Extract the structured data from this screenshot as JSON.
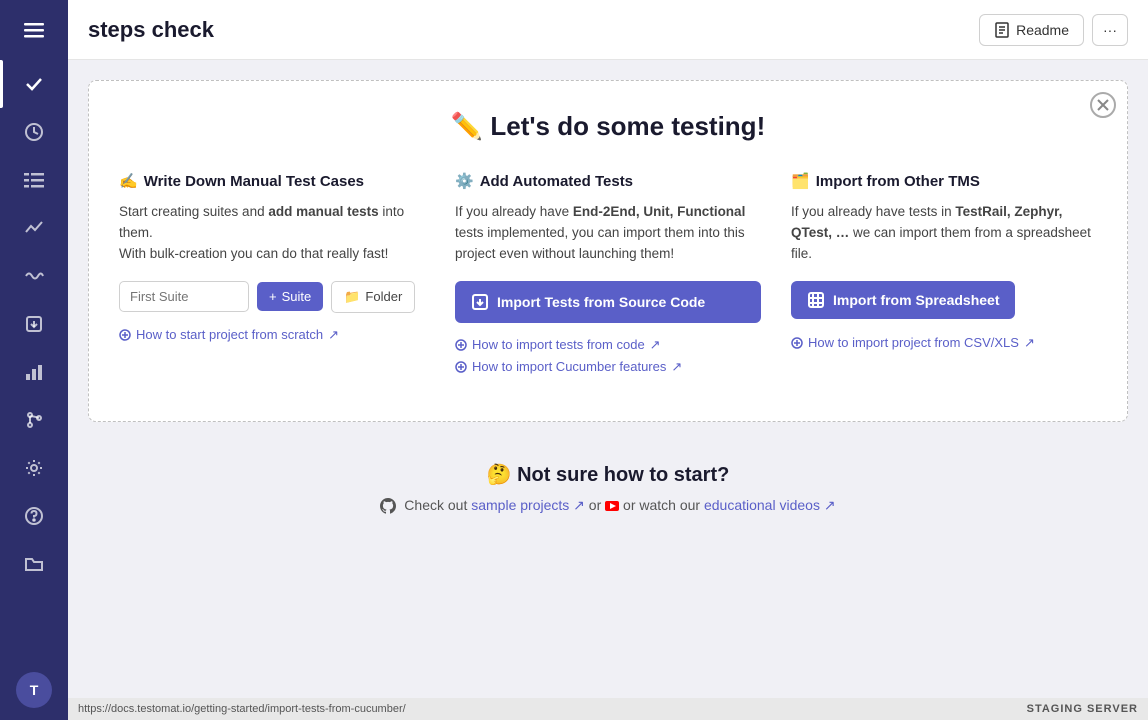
{
  "sidebar": {
    "items": [
      {
        "id": "hamburger",
        "icon": "☰"
      },
      {
        "id": "check",
        "icon": "✓",
        "active": true
      },
      {
        "id": "circle",
        "icon": "⏱"
      },
      {
        "id": "list",
        "icon": "≡"
      },
      {
        "id": "graph",
        "icon": "📈"
      },
      {
        "id": "wave",
        "icon": "〜"
      },
      {
        "id": "import",
        "icon": "⬆"
      },
      {
        "id": "chart",
        "icon": "📊"
      },
      {
        "id": "branch",
        "icon": "⑂"
      },
      {
        "id": "settings",
        "icon": "⚙"
      },
      {
        "id": "help",
        "icon": "?"
      },
      {
        "id": "folder",
        "icon": "📁"
      }
    ],
    "avatar_label": "T"
  },
  "header": {
    "title": "steps check",
    "readme_label": "Readme",
    "more_label": "···"
  },
  "card": {
    "title": "✏️ Let's do some testing!",
    "close_icon": "✕",
    "col1": {
      "icon": "✍",
      "title": "Write Down Manual Test Cases",
      "desc_plain": "Start creating suites and ",
      "desc_bold": "add manual tests",
      "desc_plain2": " into them.\nWith bulk-creation you can do that really fast!",
      "input_placeholder": "First Suite",
      "btn_suite_label": "+ Suite",
      "btn_folder_label": "📁 Folder",
      "help_link": "How to start project from scratch",
      "help_link_icon": "↗"
    },
    "col2": {
      "icon": "⚙",
      "title": "Add Automated Tests",
      "desc_plain": "If you already have ",
      "desc_bold": "End-2End, Unit, Functional",
      "desc_plain2": " tests implemented, you can import them into this project even without launching them!",
      "btn_import_label": "Import Tests from Source Code",
      "btn_import_icon": "⬆",
      "help_link1": "How to import tests from code",
      "help_link1_icon": "↗",
      "help_link2": "How to import Cucumber features",
      "help_link2_icon": "↗"
    },
    "col3": {
      "icon": "🗂",
      "title": "Import from Other TMS",
      "desc_plain": "If you already have tests in ",
      "desc_bold": "TestRail, Zephyr, QTest, …",
      "desc_plain2": " we can import them from a spreadsheet file.",
      "btn_import_label": "Import from Spreadsheet",
      "btn_import_icon": "🗂",
      "help_link": "How to import project from CSV/XLS",
      "help_link_icon": "↗"
    }
  },
  "bottom": {
    "title": "🤔 Not sure how to start?",
    "text_plain": "Check out ",
    "link1_label": "sample projects",
    "link1_icon": "↗",
    "text2": " or ",
    "text3": " or watch our ",
    "link2_label": "educational videos",
    "link2_icon": "↗"
  },
  "statusbar": {
    "url": "https://docs.testomat.io/getting-started/import-tests-from-cucumber/",
    "staging": "STAGING SERVER"
  }
}
